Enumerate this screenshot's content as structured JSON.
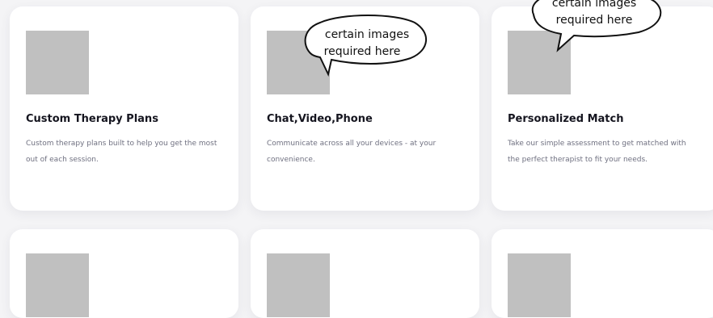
{
  "cards": [
    {
      "title": "Custom Therapy Plans",
      "description": "Custom therapy plans built to help you get the most out of each session."
    },
    {
      "title": "Chat,Video,Phone",
      "description": "Communicate across all your devices - at your convenience."
    },
    {
      "title": "Personalized Match",
      "description": "Take our simple assessment to get matched with the perfect therapist to fit your needs."
    },
    {
      "title": "",
      "description": ""
    },
    {
      "title": "",
      "description": ""
    },
    {
      "title": "",
      "description": ""
    }
  ],
  "annotations": [
    {
      "line1": "certain images",
      "line2": "required here"
    },
    {
      "line1": "certain images",
      "line2": "required here"
    }
  ],
  "colors": {
    "background": "#f4f4f6",
    "card": "#ffffff",
    "placeholder": "#c0c0c0",
    "title": "#15151f",
    "description": "#6f7080"
  }
}
